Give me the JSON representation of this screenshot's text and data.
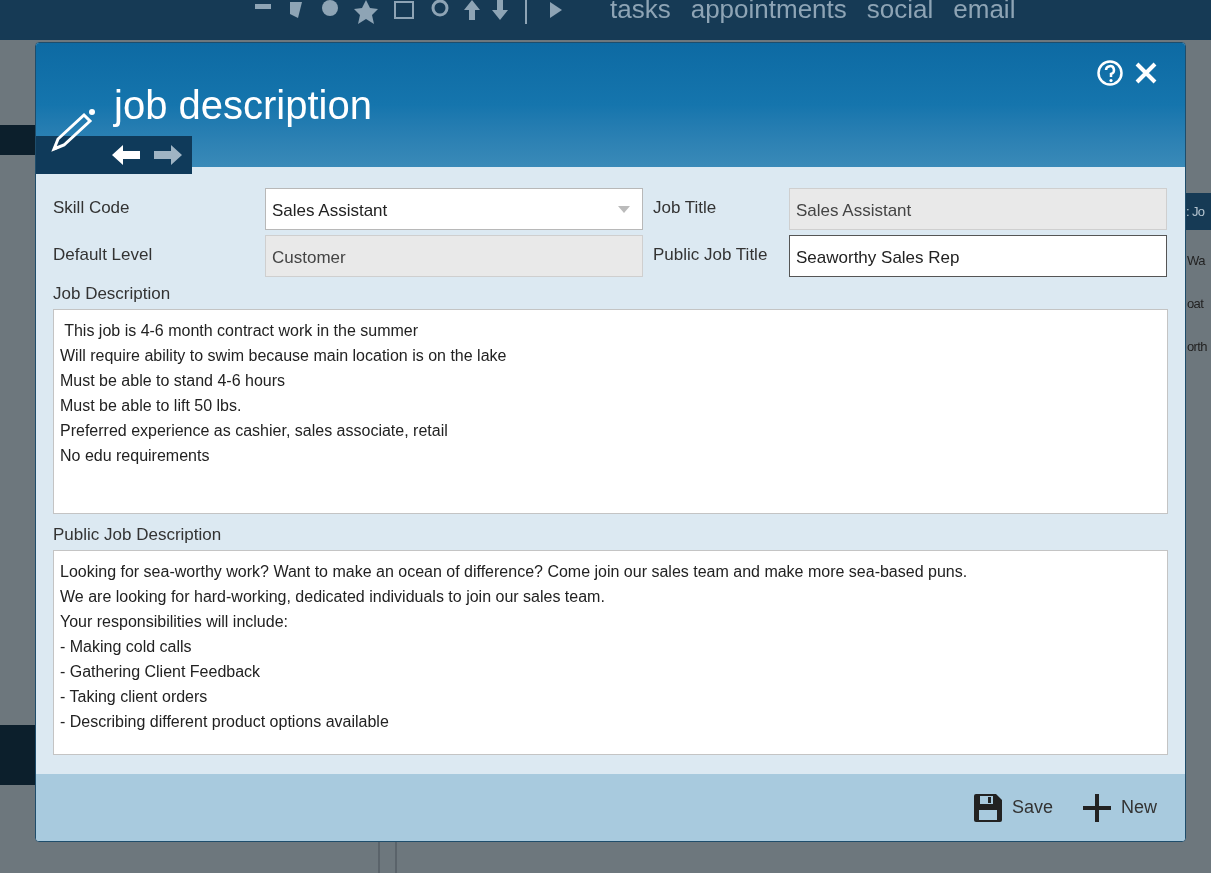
{
  "app_bar": {
    "menu": [
      "tasks",
      "appointments",
      "social",
      "email"
    ]
  },
  "background_panel": {
    "header": ": Jo",
    "rows": [
      "Wa",
      "oat",
      "orth"
    ]
  },
  "dialog": {
    "title": "job description",
    "fields": [
      {
        "kind": "select",
        "label": "Skill Code",
        "value": "Sales Assistant",
        "disabled": false
      },
      {
        "kind": "text",
        "label": "Job Title",
        "value": "Sales Assistant",
        "disabled": true
      },
      {
        "kind": "text",
        "label": "Default Level",
        "value": "Customer",
        "disabled": true
      },
      {
        "kind": "text",
        "label": "Public Job Title",
        "value": "Seaworthy Sales Rep",
        "disabled": false
      }
    ],
    "job_description": {
      "label": "Job Description",
      "lines": [
        " This job is 4-6 month contract work in the summer",
        "Will require ability to swim because main location is on the lake",
        "Must be able to stand 4-6 hours",
        "Must be able to lift 50 lbs.",
        "Preferred experience as cashier, sales associate, retail",
        "No edu requirements"
      ]
    },
    "public_job_description": {
      "label": "Public Job Description",
      "lines": [
        "Looking for sea-worthy work? Want to make an ocean of difference? Come join our sales team and make more sea-based puns.",
        "We are looking for hard-working, dedicated individuals to join our sales team.",
        "Your responsibilities will include:",
        "- Making cold calls",
        "- Gathering Client Feedback",
        "- Taking client orders",
        "- Describing different product options available"
      ]
    },
    "buttons": [
      {
        "kind": "save",
        "label": "Save"
      },
      {
        "kind": "new",
        "label": "New"
      }
    ]
  }
}
